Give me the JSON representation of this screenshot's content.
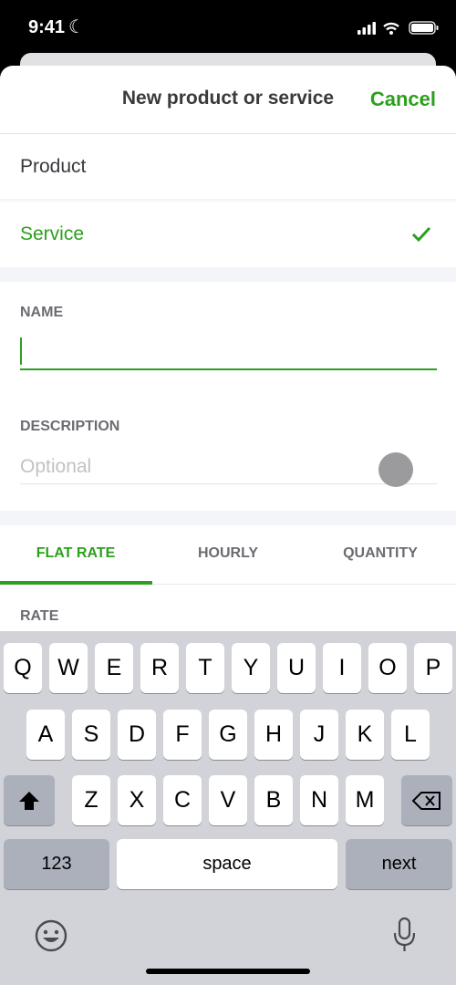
{
  "status": {
    "time": "9:41"
  },
  "header": {
    "title": "New product or service",
    "cancel": "Cancel"
  },
  "type": {
    "options": [
      "Product",
      "Service"
    ],
    "selected": "Service"
  },
  "form": {
    "name_label": "NAME",
    "name_value": "",
    "description_label": "DESCRIPTION",
    "description_placeholder": "Optional",
    "rate_label": "RATE"
  },
  "tabs": [
    {
      "label": "FLAT RATE",
      "active": true
    },
    {
      "label": "HOURLY"
    },
    {
      "label": "QUANTITY"
    }
  ],
  "keyboard": {
    "row1": [
      "Q",
      "W",
      "E",
      "R",
      "T",
      "Y",
      "U",
      "I",
      "O",
      "P"
    ],
    "row2": [
      "A",
      "S",
      "D",
      "F",
      "G",
      "H",
      "J",
      "K",
      "L"
    ],
    "row3": [
      "Z",
      "X",
      "C",
      "V",
      "B",
      "N",
      "M"
    ],
    "numbers": "123",
    "space": "space",
    "next": "next"
  },
  "colors": {
    "accent": "#2ca01c"
  }
}
